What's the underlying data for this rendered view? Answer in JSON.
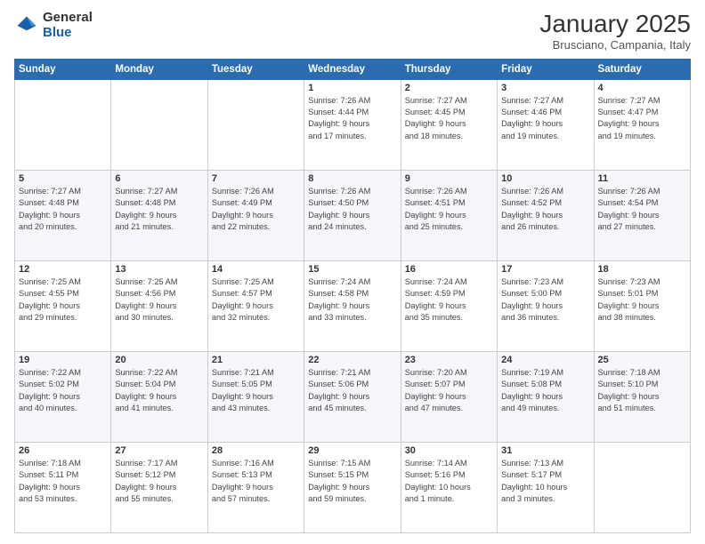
{
  "logo": {
    "general": "General",
    "blue": "Blue"
  },
  "header": {
    "month": "January 2025",
    "location": "Brusciano, Campania, Italy"
  },
  "days_of_week": [
    "Sunday",
    "Monday",
    "Tuesday",
    "Wednesday",
    "Thursday",
    "Friday",
    "Saturday"
  ],
  "weeks": [
    [
      {
        "num": "",
        "info": ""
      },
      {
        "num": "",
        "info": ""
      },
      {
        "num": "",
        "info": ""
      },
      {
        "num": "1",
        "info": "Sunrise: 7:26 AM\nSunset: 4:44 PM\nDaylight: 9 hours\nand 17 minutes."
      },
      {
        "num": "2",
        "info": "Sunrise: 7:27 AM\nSunset: 4:45 PM\nDaylight: 9 hours\nand 18 minutes."
      },
      {
        "num": "3",
        "info": "Sunrise: 7:27 AM\nSunset: 4:46 PM\nDaylight: 9 hours\nand 19 minutes."
      },
      {
        "num": "4",
        "info": "Sunrise: 7:27 AM\nSunset: 4:47 PM\nDaylight: 9 hours\nand 19 minutes."
      }
    ],
    [
      {
        "num": "5",
        "info": "Sunrise: 7:27 AM\nSunset: 4:48 PM\nDaylight: 9 hours\nand 20 minutes."
      },
      {
        "num": "6",
        "info": "Sunrise: 7:27 AM\nSunset: 4:48 PM\nDaylight: 9 hours\nand 21 minutes."
      },
      {
        "num": "7",
        "info": "Sunrise: 7:26 AM\nSunset: 4:49 PM\nDaylight: 9 hours\nand 22 minutes."
      },
      {
        "num": "8",
        "info": "Sunrise: 7:26 AM\nSunset: 4:50 PM\nDaylight: 9 hours\nand 24 minutes."
      },
      {
        "num": "9",
        "info": "Sunrise: 7:26 AM\nSunset: 4:51 PM\nDaylight: 9 hours\nand 25 minutes."
      },
      {
        "num": "10",
        "info": "Sunrise: 7:26 AM\nSunset: 4:52 PM\nDaylight: 9 hours\nand 26 minutes."
      },
      {
        "num": "11",
        "info": "Sunrise: 7:26 AM\nSunset: 4:54 PM\nDaylight: 9 hours\nand 27 minutes."
      }
    ],
    [
      {
        "num": "12",
        "info": "Sunrise: 7:25 AM\nSunset: 4:55 PM\nDaylight: 9 hours\nand 29 minutes."
      },
      {
        "num": "13",
        "info": "Sunrise: 7:25 AM\nSunset: 4:56 PM\nDaylight: 9 hours\nand 30 minutes."
      },
      {
        "num": "14",
        "info": "Sunrise: 7:25 AM\nSunset: 4:57 PM\nDaylight: 9 hours\nand 32 minutes."
      },
      {
        "num": "15",
        "info": "Sunrise: 7:24 AM\nSunset: 4:58 PM\nDaylight: 9 hours\nand 33 minutes."
      },
      {
        "num": "16",
        "info": "Sunrise: 7:24 AM\nSunset: 4:59 PM\nDaylight: 9 hours\nand 35 minutes."
      },
      {
        "num": "17",
        "info": "Sunrise: 7:23 AM\nSunset: 5:00 PM\nDaylight: 9 hours\nand 36 minutes."
      },
      {
        "num": "18",
        "info": "Sunrise: 7:23 AM\nSunset: 5:01 PM\nDaylight: 9 hours\nand 38 minutes."
      }
    ],
    [
      {
        "num": "19",
        "info": "Sunrise: 7:22 AM\nSunset: 5:02 PM\nDaylight: 9 hours\nand 40 minutes."
      },
      {
        "num": "20",
        "info": "Sunrise: 7:22 AM\nSunset: 5:04 PM\nDaylight: 9 hours\nand 41 minutes."
      },
      {
        "num": "21",
        "info": "Sunrise: 7:21 AM\nSunset: 5:05 PM\nDaylight: 9 hours\nand 43 minutes."
      },
      {
        "num": "22",
        "info": "Sunrise: 7:21 AM\nSunset: 5:06 PM\nDaylight: 9 hours\nand 45 minutes."
      },
      {
        "num": "23",
        "info": "Sunrise: 7:20 AM\nSunset: 5:07 PM\nDaylight: 9 hours\nand 47 minutes."
      },
      {
        "num": "24",
        "info": "Sunrise: 7:19 AM\nSunset: 5:08 PM\nDaylight: 9 hours\nand 49 minutes."
      },
      {
        "num": "25",
        "info": "Sunrise: 7:18 AM\nSunset: 5:10 PM\nDaylight: 9 hours\nand 51 minutes."
      }
    ],
    [
      {
        "num": "26",
        "info": "Sunrise: 7:18 AM\nSunset: 5:11 PM\nDaylight: 9 hours\nand 53 minutes."
      },
      {
        "num": "27",
        "info": "Sunrise: 7:17 AM\nSunset: 5:12 PM\nDaylight: 9 hours\nand 55 minutes."
      },
      {
        "num": "28",
        "info": "Sunrise: 7:16 AM\nSunset: 5:13 PM\nDaylight: 9 hours\nand 57 minutes."
      },
      {
        "num": "29",
        "info": "Sunrise: 7:15 AM\nSunset: 5:15 PM\nDaylight: 9 hours\nand 59 minutes."
      },
      {
        "num": "30",
        "info": "Sunrise: 7:14 AM\nSunset: 5:16 PM\nDaylight: 10 hours\nand 1 minute."
      },
      {
        "num": "31",
        "info": "Sunrise: 7:13 AM\nSunset: 5:17 PM\nDaylight: 10 hours\nand 3 minutes."
      },
      {
        "num": "",
        "info": ""
      }
    ]
  ]
}
